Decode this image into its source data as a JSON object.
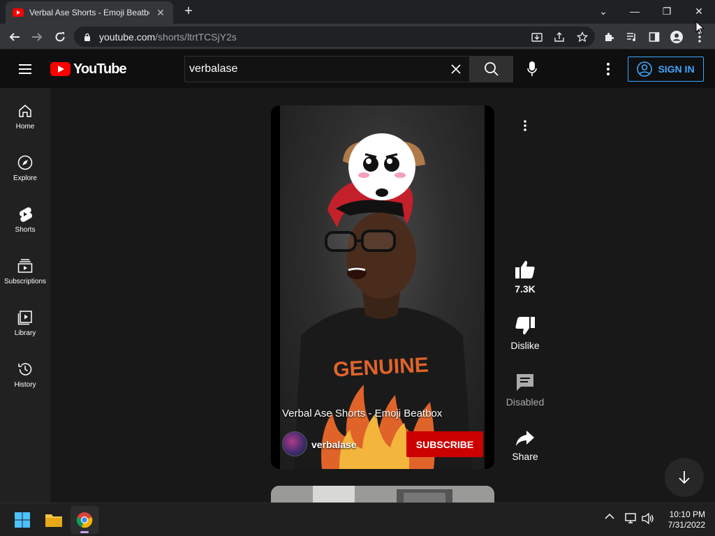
{
  "browser": {
    "tab_title": "Verbal Ase Shorts - Emoji Beatbox",
    "url_host": "youtube.com",
    "url_path": "/shorts/ltrtTCSjY2s"
  },
  "masthead": {
    "logo_text": "YouTube",
    "search_value": "verbalase",
    "signin_label": "SIGN IN"
  },
  "sidebar": {
    "items": [
      {
        "label": "Home",
        "icon": "home-icon"
      },
      {
        "label": "Explore",
        "icon": "compass-icon"
      },
      {
        "label": "Shorts",
        "icon": "shorts-icon"
      },
      {
        "label": "Subscriptions",
        "icon": "subscriptions-icon"
      },
      {
        "label": "Library",
        "icon": "library-icon"
      },
      {
        "label": "History",
        "icon": "history-icon"
      }
    ]
  },
  "short": {
    "title": "Verbal Ase Shorts - Emoji Beatbox",
    "channel": "verbalase",
    "subscribe_label": "SUBSCRIBE",
    "shirt_text": "GENUINE"
  },
  "actions": {
    "like_count": "7.3K",
    "dislike_label": "Dislike",
    "comments_label": "Disabled",
    "share_label": "Share"
  },
  "taskbar": {
    "time": "10:10 PM",
    "date": "7/31/2022"
  },
  "colors": {
    "accent_red": "#ff0000",
    "subscribe_red": "#cc0000",
    "signin_blue": "#3ea6ff"
  }
}
